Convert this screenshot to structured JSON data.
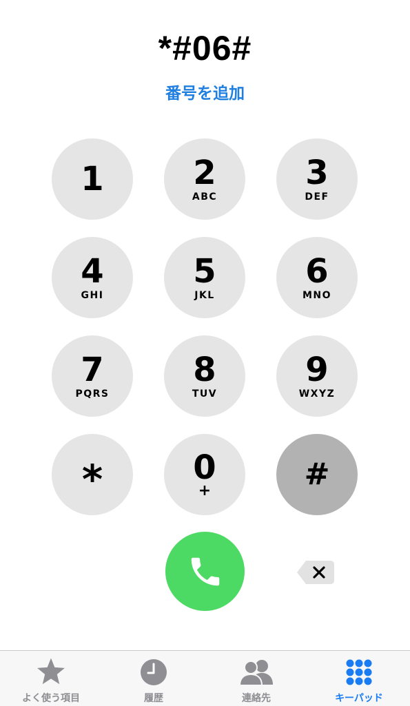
{
  "display": {
    "number": "*#06#"
  },
  "add_number_label": "番号を追加",
  "keypad": {
    "keys": [
      {
        "digit": "1",
        "letters": ""
      },
      {
        "digit": "2",
        "letters": "ABC"
      },
      {
        "digit": "3",
        "letters": "DEF"
      },
      {
        "digit": "4",
        "letters": "GHI"
      },
      {
        "digit": "5",
        "letters": "JKL"
      },
      {
        "digit": "6",
        "letters": "MNO"
      },
      {
        "digit": "7",
        "letters": "PQRS"
      },
      {
        "digit": "8",
        "letters": "TUV"
      },
      {
        "digit": "9",
        "letters": "WXYZ"
      },
      {
        "digit": "*",
        "letters": ""
      },
      {
        "digit": "0",
        "letters": "+"
      },
      {
        "digit": "#",
        "letters": ""
      }
    ],
    "pressed_key": "#"
  },
  "colors": {
    "key_background": "#e5e5e5",
    "key_pressed_background": "#b2b2b2",
    "call_button": "#4cd964",
    "accent_blue": "#1a7cf2",
    "inactive_tab": "#8e8e93"
  },
  "icons": {
    "call": "phone-icon",
    "delete": "backspace-icon"
  },
  "tabbar": {
    "tabs": [
      {
        "label": "よく使う項目",
        "icon": "star-icon",
        "active": false
      },
      {
        "label": "履歴",
        "icon": "clock-icon",
        "active": false
      },
      {
        "label": "連絡先",
        "icon": "contacts-icon",
        "active": false
      },
      {
        "label": "キーパッド",
        "icon": "keypad-icon",
        "active": true
      }
    ]
  }
}
